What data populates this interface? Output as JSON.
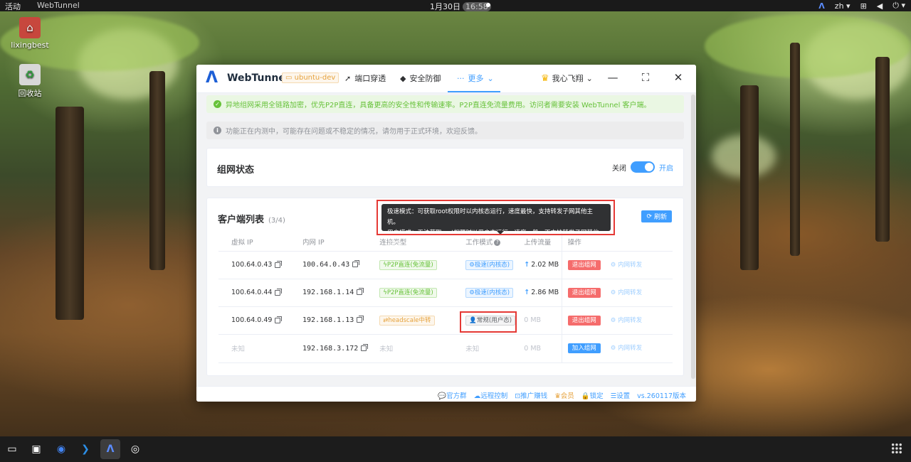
{
  "topbar": {
    "activities": "活动",
    "app_name": "WebTunnel",
    "date": "1月30日",
    "time": "16:58",
    "lang": "zh"
  },
  "desktop": {
    "icons": [
      {
        "label": "lixingbest"
      },
      {
        "label": "回收站"
      }
    ]
  },
  "window": {
    "logo": "WebTunnel",
    "host": "ubuntu-dev",
    "nav": [
      {
        "label": "端口穿透"
      },
      {
        "label": "安全防御"
      },
      {
        "label": "更多"
      }
    ],
    "user": "我心飞翔",
    "alerts": {
      "success": "异地组网采用全链路加密，优先P2P直连，具备更高的安全性和传输速率。P2P直连免流量费用。访问者需要安装 WebTunnel 客户端。",
      "info": "功能正在内测中，可能存在问题或不稳定的情况，请勿用于正式环境，欢迎反馈。"
    },
    "network_status": {
      "title": "组网状态",
      "off_label": "关闭",
      "on_label": "开启",
      "enabled": true
    },
    "clients": {
      "title": "客户端列表",
      "count": "(3/4)",
      "refresh": "刷新",
      "columns": [
        "虚拟 IP",
        "内网 IP",
        "连接类型",
        "工作模式",
        "上传流量",
        "操作"
      ],
      "rows": [
        {
          "vip": "100.64.0.43",
          "lan": "100.64.0.43",
          "conn": "P2P直连(免流量)",
          "mode": "极速(内核态)",
          "upload": "2.02 MB",
          "action": "退出组网",
          "forward": "内网转发"
        },
        {
          "vip": "100.64.0.44",
          "lan": "192.168.1.14",
          "conn": "P2P直连(免流量)",
          "mode": "极速(内核态)",
          "upload": "2.86 MB",
          "action": "退出组网",
          "forward": "内网转发"
        },
        {
          "vip": "100.64.0.49",
          "lan": "192.168.1.13",
          "conn": "headscale中转",
          "mode": "常规(用户态)",
          "upload": "0 MB",
          "action": "退出组网",
          "forward": "内网转发"
        },
        {
          "vip": "未知",
          "lan": "192.168.3.172",
          "conn": "未知",
          "mode": "未知",
          "upload": "0 MB",
          "action": "加入组网",
          "forward": "内网转发"
        }
      ]
    },
    "tooltip": {
      "line1": "极速模式：可获取root权限时以内核态运行，速度最快，支持转发子网其他主机。",
      "line2": "用户模式：无法获取root权限时以用户态运行，速度一般，不支持转发子网其他主机。"
    },
    "footer": {
      "official": "官方群",
      "remote": "远程控制",
      "promo": "推广赚钱",
      "vip": "会员",
      "lock": "锁定",
      "settings": "设置",
      "version": "vs.260117版本"
    }
  }
}
